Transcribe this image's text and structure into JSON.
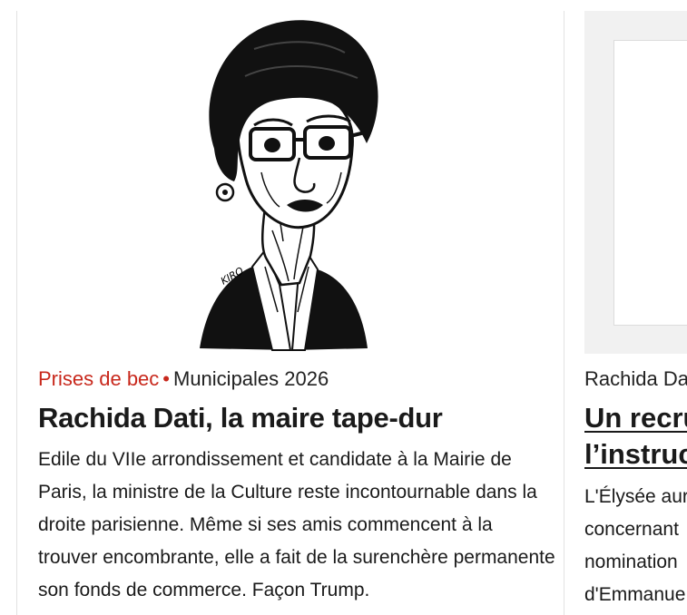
{
  "article_main": {
    "rubric": "Prises de bec",
    "bullet": "•",
    "tag": "Municipales 2026",
    "title": "Rachida Dati, la maire tape-dur",
    "description": "Edile du VIIe arrondissement et candidate à la Mairie de Paris, la ministre de la Culture reste incontournable dans la droite parisienne. Même si ses amis commencent à la trouver encombrante, elle a fait de la surenchère permanente son fonds de commerce. Façon Trump.",
    "illustration": "caricature-illustration",
    "signature": "KIRO"
  },
  "article_secondary": {
    "tag": "Rachida Dat",
    "title_lines": [
      "Un recru",
      "l’instruc"
    ],
    "description_lines": [
      "L'Élysée aur",
      "concernant",
      "nomination",
      "d'Emmanue"
    ]
  },
  "colors": {
    "rubric": "#c8281c",
    "text": "#1a1a1a",
    "divider": "#e2e2e2",
    "placeholder_bg": "#f1f1f1"
  }
}
